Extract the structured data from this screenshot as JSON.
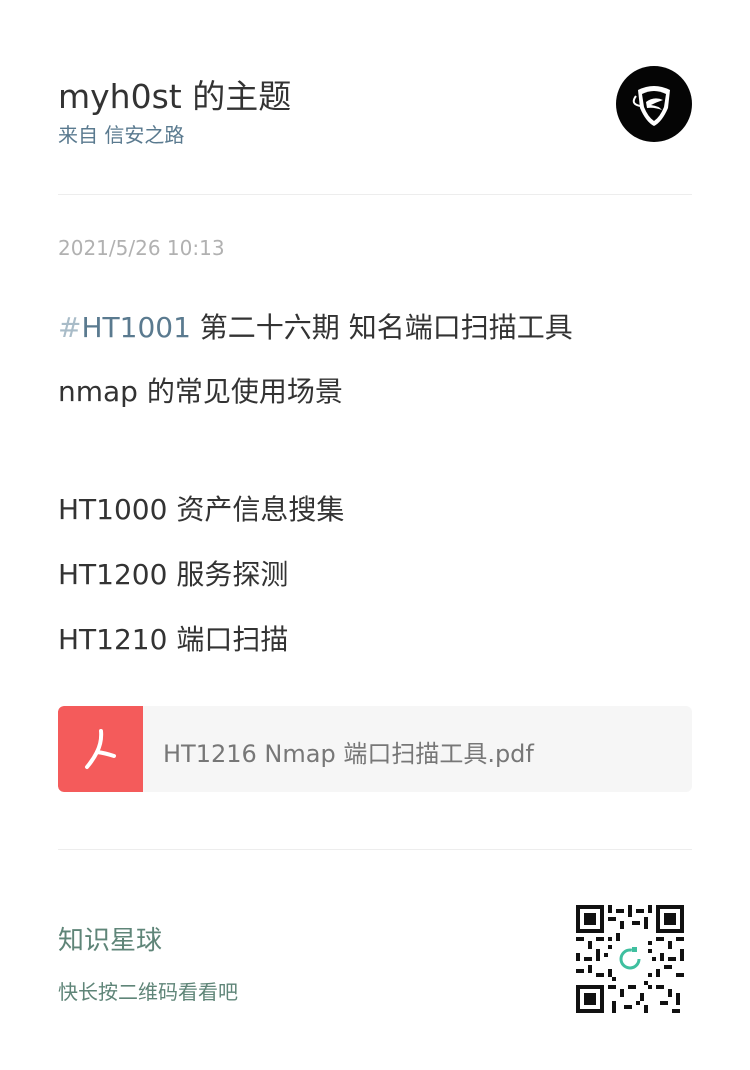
{
  "header": {
    "title": "myh0st 的主题",
    "subtitle": "来自 信安之路",
    "avatar_icon": "shield-logo-icon"
  },
  "post": {
    "timestamp": "2021/5/26 10:13",
    "hash_sign": "#",
    "hashtag": "HT1001",
    "line1_rest": " 第二十六期  知名端口扫描工具",
    "line2": "nmap  的常见使用场景",
    "line3": "HT1000  资产信息搜集",
    "line4": "HT1200  服务探测",
    "line5": "HT1210  端口扫描"
  },
  "attachment": {
    "icon": "pdf-file-icon",
    "name": "HT1216 Nmap 端口扫描工具.pdf"
  },
  "footer": {
    "title": "知识星球",
    "hint": "快长按二维码看看吧",
    "qr_icon": "qr-code-icon"
  },
  "colors": {
    "hashtag": "#5a7a8f",
    "pdf_badge": "#f45b5b",
    "footer_text": "#5f8578",
    "qr_logo": "#3fbf9f"
  }
}
